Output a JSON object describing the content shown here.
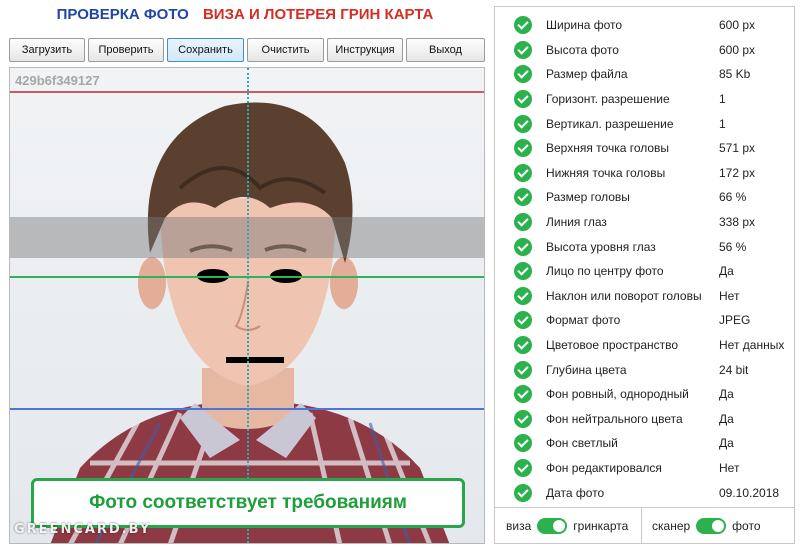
{
  "header": {
    "title_left": "ПРОВЕРКА ФОТО",
    "title_right": "ВИЗА И ЛОТЕРЕЯ ГРИН КАРТА"
  },
  "toolbar": [
    {
      "label": "Загрузить",
      "name": "load-button"
    },
    {
      "label": "Проверить",
      "name": "check-button"
    },
    {
      "label": "Сохранить",
      "name": "save-button"
    },
    {
      "label": "Очистить",
      "name": "clear-button"
    },
    {
      "label": "Инструкция",
      "name": "instructions-button"
    },
    {
      "label": "Выход",
      "name": "exit-button"
    }
  ],
  "photo": {
    "id": "429b6f349127",
    "result_message": "Фото соответствует требованиям",
    "watermark": "GREENCARD.BY"
  },
  "checks": [
    {
      "label": "Ширина фото",
      "value": "600 px"
    },
    {
      "label": "Высота фото",
      "value": "600 px"
    },
    {
      "label": "Размер файла",
      "value": "85 Kb"
    },
    {
      "label": "Горизонт. разрешение",
      "value": "1"
    },
    {
      "label": "Вертикал. разрешение",
      "value": "1"
    },
    {
      "label": "Верхняя точка головы",
      "value": "571 px"
    },
    {
      "label": "Нижняя точка головы",
      "value": "172 px"
    },
    {
      "label": "Размер головы",
      "value": "66 %"
    },
    {
      "label": "Линия глаз",
      "value": "338 px"
    },
    {
      "label": "Высота уровня глаз",
      "value": "56 %"
    },
    {
      "label": "Лицо по центру фото",
      "value": "Да"
    },
    {
      "label": "Наклон или поворот головы",
      "value": "Нет"
    },
    {
      "label": "Формат фото",
      "value": "JPEG"
    },
    {
      "label": "Цветовое пространство",
      "value": "Нет данных"
    },
    {
      "label": "Глубина цвета",
      "value": "24 bit"
    },
    {
      "label": "Фон ровный, однородный",
      "value": "Да"
    },
    {
      "label": "Фон нейтрального цвета",
      "value": "Да"
    },
    {
      "label": "Фон светлый",
      "value": "Да"
    },
    {
      "label": "Фон редактировался",
      "value": "Нет"
    },
    {
      "label": "Дата фото",
      "value": "09.10.2018"
    }
  ],
  "switches": {
    "mode_left": "виза",
    "mode_right": "гринкарта",
    "source_left": "сканер",
    "source_right": "фото"
  },
  "colors": {
    "accent_green": "#2bb24c",
    "title_blue": "#1f46a8",
    "title_red": "#d42d25"
  }
}
